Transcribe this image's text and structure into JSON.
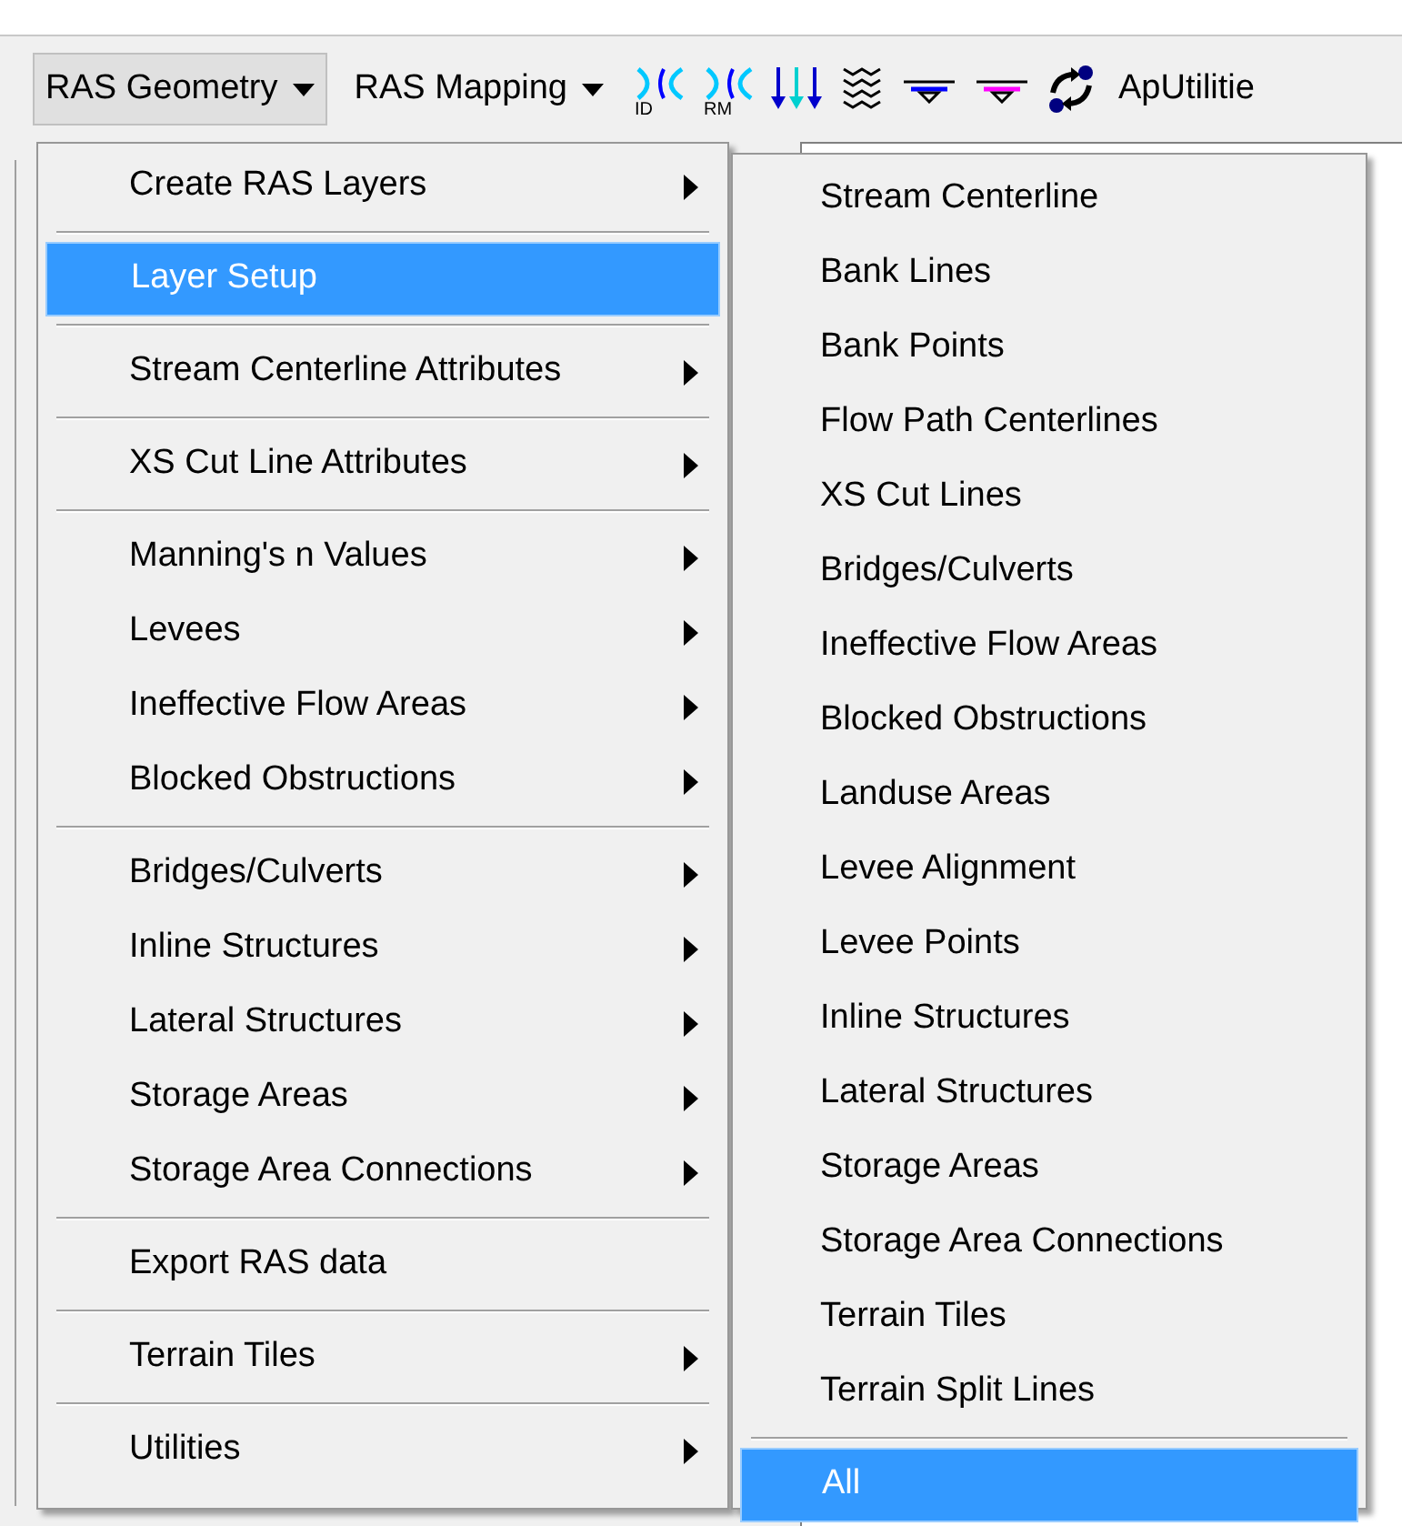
{
  "toolbar": {
    "menus": [
      {
        "label": "RAS Geometry",
        "pressed": true
      },
      {
        "label": "RAS Mapping",
        "pressed": false
      }
    ],
    "tools": [
      {
        "kind": "xs",
        "label": "ID"
      },
      {
        "kind": "xs",
        "label": "RM"
      },
      {
        "kind": "arrows"
      },
      {
        "kind": "stack"
      },
      {
        "kind": "levee",
        "color": "#0000ff"
      },
      {
        "kind": "levee",
        "color": "#ff00ff"
      },
      {
        "kind": "sync"
      }
    ],
    "trailing_menu": {
      "label": "ApUtilitie"
    }
  },
  "menu": {
    "items": [
      {
        "kind": "item",
        "label": "Create RAS Layers",
        "submenu": true,
        "selected": false
      },
      {
        "kind": "separator"
      },
      {
        "kind": "item",
        "label": "Layer Setup",
        "submenu": false,
        "selected": true
      },
      {
        "kind": "separator"
      },
      {
        "kind": "item",
        "label": "Stream Centerline Attributes",
        "submenu": true,
        "selected": false
      },
      {
        "kind": "separator"
      },
      {
        "kind": "item",
        "label": "XS Cut Line Attributes",
        "submenu": true,
        "selected": false
      },
      {
        "kind": "separator"
      },
      {
        "kind": "item",
        "label": "Manning's n Values",
        "submenu": true,
        "selected": false
      },
      {
        "kind": "item",
        "label": "Levees",
        "submenu": true,
        "selected": false
      },
      {
        "kind": "item",
        "label": "Ineffective Flow Areas",
        "submenu": true,
        "selected": false
      },
      {
        "kind": "item",
        "label": "Blocked Obstructions",
        "submenu": true,
        "selected": false
      },
      {
        "kind": "separator"
      },
      {
        "kind": "item",
        "label": "Bridges/Culverts",
        "submenu": true,
        "selected": false
      },
      {
        "kind": "item",
        "label": "Inline Structures",
        "submenu": true,
        "selected": false
      },
      {
        "kind": "item",
        "label": "Lateral Structures",
        "submenu": true,
        "selected": false
      },
      {
        "kind": "item",
        "label": "Storage Areas",
        "submenu": true,
        "selected": false
      },
      {
        "kind": "item",
        "label": "Storage Area Connections",
        "submenu": true,
        "selected": false
      },
      {
        "kind": "separator"
      },
      {
        "kind": "item",
        "label": "Export RAS data",
        "submenu": false,
        "selected": false
      },
      {
        "kind": "separator"
      },
      {
        "kind": "item",
        "label": "Terrain Tiles",
        "submenu": true,
        "selected": false
      },
      {
        "kind": "separator"
      },
      {
        "kind": "item",
        "label": "Utilities",
        "submenu": true,
        "selected": false
      }
    ]
  },
  "submenu": {
    "items": [
      {
        "kind": "item",
        "label": "Stream Centerline",
        "selected": false
      },
      {
        "kind": "item",
        "label": "Bank Lines",
        "selected": false
      },
      {
        "kind": "item",
        "label": "Bank Points",
        "selected": false
      },
      {
        "kind": "item",
        "label": "Flow Path Centerlines",
        "selected": false
      },
      {
        "kind": "item",
        "label": "XS Cut Lines",
        "selected": false
      },
      {
        "kind": "item",
        "label": "Bridges/Culverts",
        "selected": false
      },
      {
        "kind": "item",
        "label": "Ineffective Flow Areas",
        "selected": false
      },
      {
        "kind": "item",
        "label": "Blocked Obstructions",
        "selected": false
      },
      {
        "kind": "item",
        "label": "Landuse Areas",
        "selected": false
      },
      {
        "kind": "item",
        "label": "Levee Alignment",
        "selected": false
      },
      {
        "kind": "item",
        "label": "Levee Points",
        "selected": false
      },
      {
        "kind": "item",
        "label": "Inline Structures",
        "selected": false
      },
      {
        "kind": "item",
        "label": "Lateral Structures",
        "selected": false
      },
      {
        "kind": "item",
        "label": "Storage Areas",
        "selected": false
      },
      {
        "kind": "item",
        "label": "Storage Area Connections",
        "selected": false
      },
      {
        "kind": "item",
        "label": "Terrain Tiles",
        "selected": false
      },
      {
        "kind": "item",
        "label": "Terrain Split Lines",
        "selected": false
      },
      {
        "kind": "separator"
      },
      {
        "kind": "item",
        "label": "All",
        "selected": true
      }
    ]
  }
}
